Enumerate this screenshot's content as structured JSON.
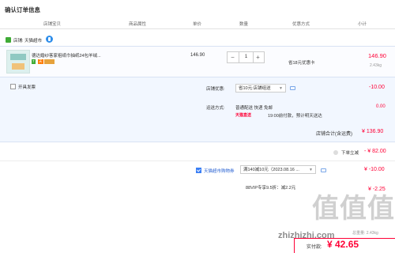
{
  "title": "确认订单信息",
  "columns": [
    "店铺宝贝",
    "商品属性",
    "单价",
    "数量",
    "优惠方式",
    "小计"
  ],
  "store": {
    "label": "店铺: 天猫超市"
  },
  "product": {
    "name": "德达婚纱客家祖纸巾抽纸24包羊绒...",
    "badges": [
      "7",
      "天"
    ],
    "unit_price": "146.90",
    "quantity": "1",
    "qty_minus": "−",
    "qty_plus": "+",
    "discount": "省18元优惠卡",
    "subtotal": "146.90",
    "weight": "2.43kg"
  },
  "invoice": {
    "label": "开具发票"
  },
  "store_discount": {
    "label": "店铺优惠:",
    "value": "省10元:店铺组送",
    "amount": "-10.00"
  },
  "shipping": {
    "label": "运送方式:",
    "method": "普通配送 快递 免邮",
    "tmall_label": "天猫直送",
    "eta": "19:00前付款，预计明天送达",
    "amount": "0.00"
  },
  "store_total": {
    "label": "店铺合计(含运费)",
    "amount": "¥ 136.90"
  },
  "instant_discount": {
    "label": "下单立减",
    "amount": "- ¥ 82.00"
  },
  "coupon": {
    "label": "天猫超市购物券",
    "value": "满140减10元（2023.08.16 ...",
    "amount": "¥ -10.00"
  },
  "vip": {
    "value": "88VIP专享9.5折：减2.2元",
    "amount": "¥ -2.25"
  },
  "watermark": {
    "big": "值值值",
    "site": "zhizhizhi.com"
  },
  "total": {
    "weight_label": "总重量: 2.43kg",
    "pay_label": "实付款:",
    "amount": "¥ 42.65"
  },
  "colors": {
    "accent": "#ff0036",
    "brand_blue": "#3b7ff5",
    "panel_bg": "#f2f7ff"
  }
}
